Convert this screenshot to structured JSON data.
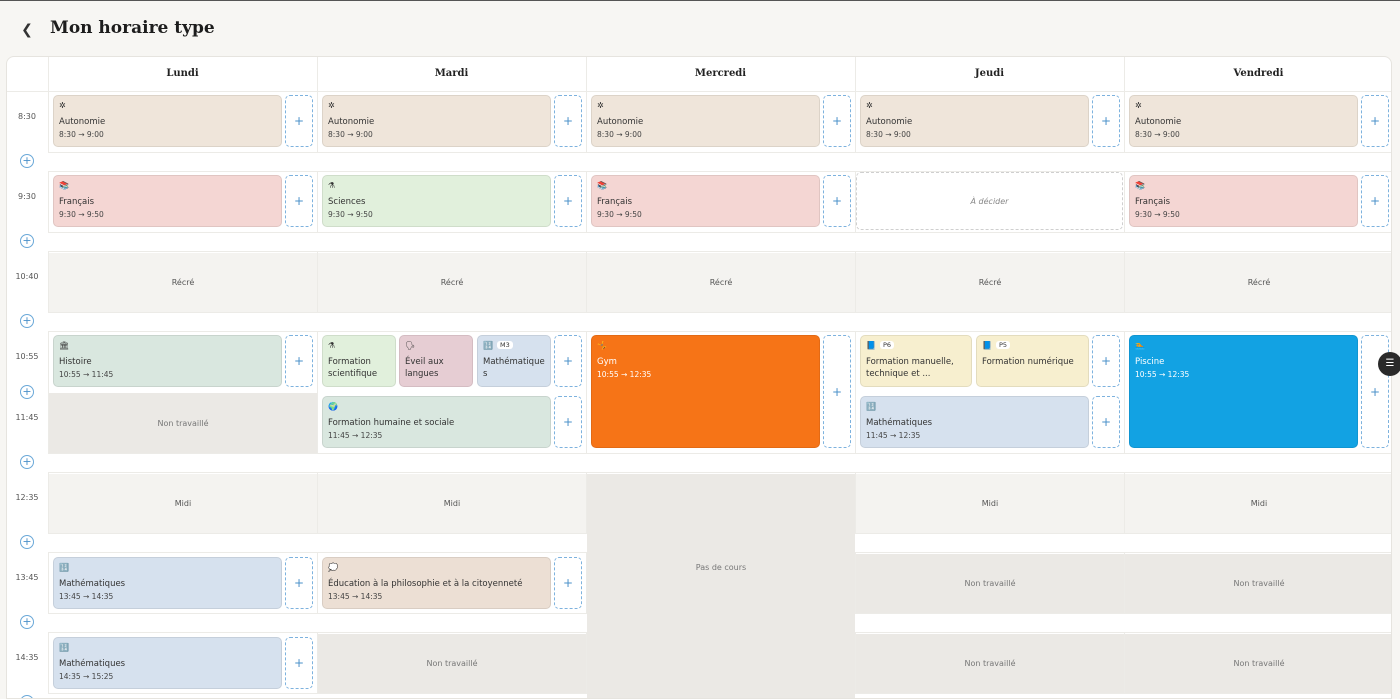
{
  "header": {
    "title": "Mon horaire type",
    "back_icon": "chevron-left-icon"
  },
  "days": [
    "Lundi",
    "Mardi",
    "Mercredi",
    "Jeudi",
    "Vendredi"
  ],
  "times": [
    "8:30",
    "9:30",
    "10:40",
    "10:55",
    "11:45",
    "12:35",
    "13:45",
    "14:35"
  ],
  "add_label": "+",
  "labels": {
    "recre": "Récré",
    "midi": "Midi",
    "non_travaille": "Non travaillé",
    "pas_de_cours": "Pas de cours",
    "a_decider": "À décider"
  },
  "courses": {
    "autonomie": {
      "name": "Autonomie",
      "time": "8:30 → 9:00",
      "icon": "✲"
    },
    "francais": {
      "name": "Français",
      "time": "9:30 → 9:50",
      "icon": "📚"
    },
    "sciences": {
      "name": "Sciences",
      "time": "9:30 → 9:50",
      "icon": "⚗"
    },
    "histoire": {
      "name": "Histoire",
      "time": "10:55 → 11:45",
      "icon": "🏛"
    },
    "formation_sci": {
      "name": "Formation scientifique",
      "icon": "⚗"
    },
    "eveil": {
      "name": "Éveil aux langues",
      "icon": "🗣"
    },
    "maths_m3": {
      "name": "Mathématique s",
      "badge": "M3",
      "icon": "🔢"
    },
    "formation_hs": {
      "name": "Formation humaine et sociale",
      "time": "11:45 → 12:35",
      "icon": "🌍"
    },
    "gym": {
      "name": "Gym",
      "time": "10:55 → 12:35",
      "icon": "🤸"
    },
    "formation_man": {
      "name": "Formation manuelle, technique et ...",
      "badge": "P6",
      "icon": "📘"
    },
    "formation_num": {
      "name": "Formation numérique",
      "badge": "P5",
      "icon": "📘"
    },
    "maths_jeudi": {
      "name": "Mathématiques",
      "time": "11:45 → 12:35",
      "icon": "🔢"
    },
    "piscine": {
      "name": "Piscine",
      "time": "10:55 → 12:35",
      "icon": "🏊"
    },
    "maths_1345": {
      "name": "Mathématiques",
      "time": "13:45 → 14:35",
      "icon": "🔢"
    },
    "philo": {
      "name": "Éducation à la philosophie et à la citoyenneté",
      "time": "13:45 → 14:35",
      "icon": "💭"
    },
    "maths_1435": {
      "name": "Mathématiques",
      "time": "14:35 → 15:25",
      "icon": "🔢"
    }
  },
  "float_icon": "filter-icon"
}
